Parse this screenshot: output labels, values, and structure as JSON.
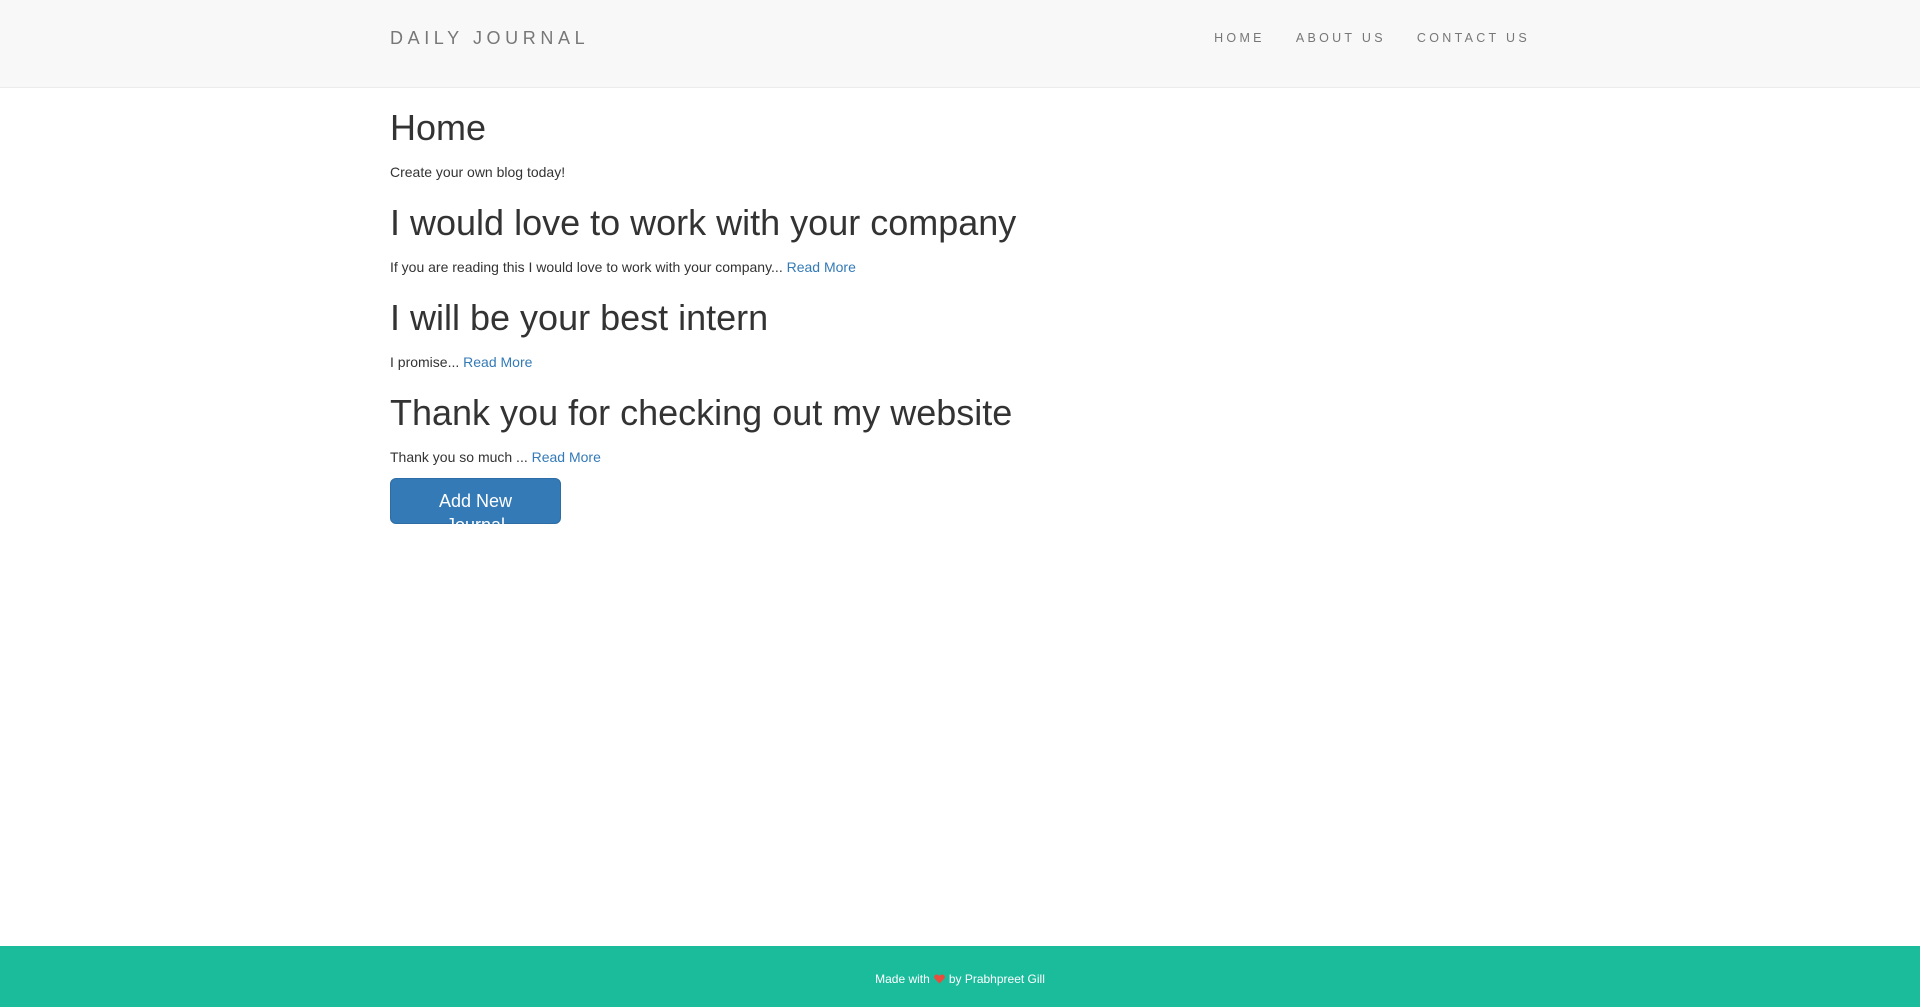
{
  "navbar": {
    "brand": "DAILY JOURNAL",
    "links": [
      "HOME",
      "ABOUT US",
      "CONTACT US"
    ]
  },
  "home": {
    "title": "Home",
    "intro": "Create your own blog today!"
  },
  "posts": [
    {
      "title": "I would love to work with your company",
      "excerpt": "If you are reading this I would love to work with your company...",
      "link": "Read More"
    },
    {
      "title": "I will be your best intern",
      "excerpt": "I promise...",
      "link": "Read More"
    },
    {
      "title": "Thank you for checking out my website",
      "excerpt": "Thank you so much ...",
      "link": "Read More"
    }
  ],
  "actions": {
    "add_label": "Add New Journal"
  },
  "footer": {
    "prefix": "Made with",
    "heart_icon": "heart-icon",
    "suffix": "by Prabhpreet Gill"
  },
  "colors": {
    "navbar_bg": "#f8f8f8",
    "link": "#337ab7",
    "button": "#337ab7",
    "footer_bg": "#1abc9c",
    "heart": "#e74c3c"
  }
}
